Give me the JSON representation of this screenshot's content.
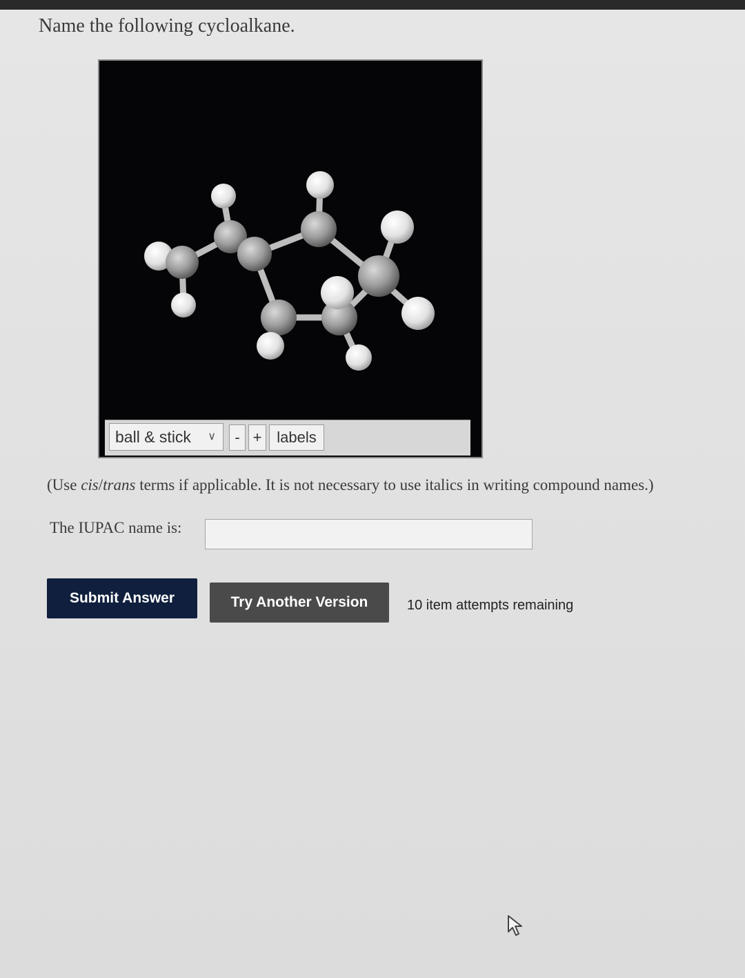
{
  "question": {
    "title": "Name the following cycloalkane."
  },
  "viewer": {
    "display_mode": "ball & stick",
    "zoom_out_label": "-",
    "zoom_in_label": "+",
    "labels_label": "labels"
  },
  "instructions": {
    "prefix": "(Use ",
    "cis": "cis",
    "slash": "/",
    "trans": "trans",
    "suffix": " terms if applicable. It is not necessary to use italics in writing compound names.)"
  },
  "answer": {
    "label": "The IUPAC name is:",
    "value": ""
  },
  "actions": {
    "submit_label": "Submit Answer",
    "try_another_label": "Try Another Version",
    "attempts_text": "10 item attempts remaining"
  },
  "colors": {
    "submit_bg": "#0f1f3d",
    "try_bg": "#4a4a4a",
    "viewer_bg": "#050508"
  }
}
